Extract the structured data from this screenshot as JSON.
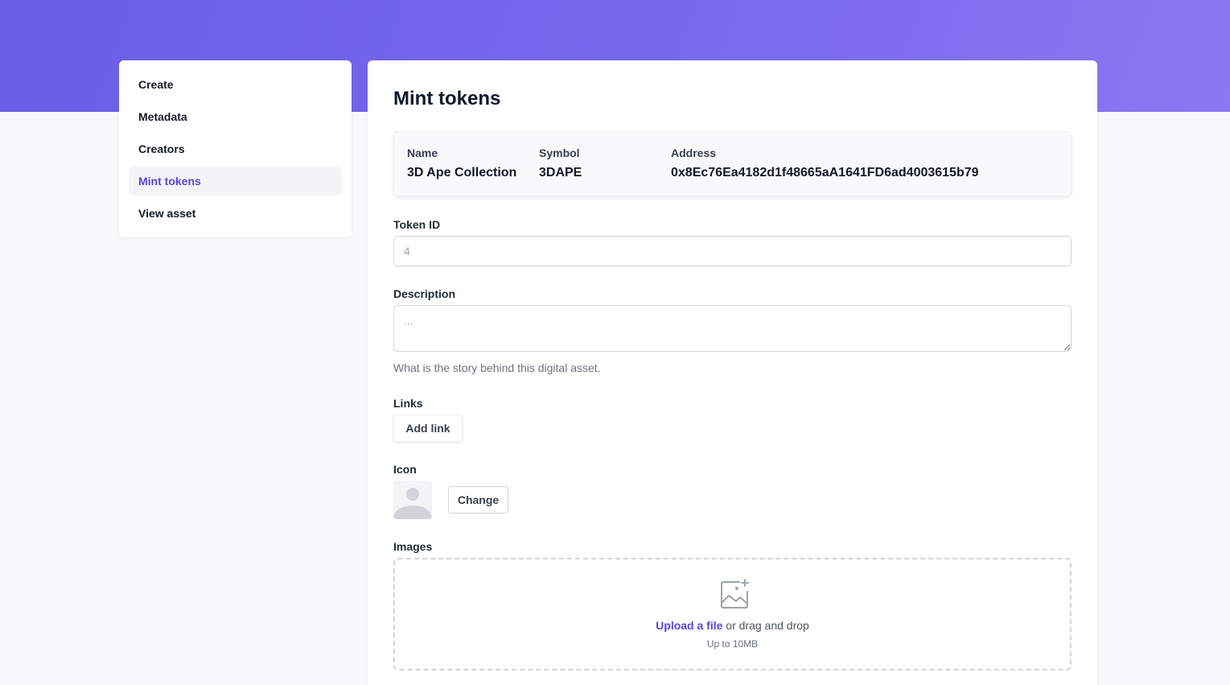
{
  "sidebar": {
    "items": [
      {
        "label": "Create"
      },
      {
        "label": "Metadata"
      },
      {
        "label": "Creators"
      },
      {
        "label": "Mint tokens",
        "active": true
      },
      {
        "label": "View asset"
      }
    ]
  },
  "main": {
    "title": "Mint tokens",
    "info": {
      "name_label": "Name",
      "name_value": "3D Ape Collection",
      "symbol_label": "Symbol",
      "symbol_value": "3DAPE",
      "address_label": "Address",
      "address_value": "0x8Ec76Ea4182d1f48665aA1641FD6ad4003615b79"
    },
    "token_id": {
      "label": "Token ID",
      "placeholder": "4",
      "value": ""
    },
    "description": {
      "label": "Description",
      "placeholder": "...",
      "help": "What is the story behind this digital asset."
    },
    "links": {
      "label": "Links",
      "add_button": "Add link"
    },
    "icon": {
      "label": "Icon",
      "change_button": "Change"
    },
    "images": {
      "label": "Images",
      "upload_link": "Upload a file",
      "upload_rest": " or drag and drop",
      "limit": "Up to 10MB"
    }
  },
  "colors": {
    "accent": "#5b45d6",
    "header_gradient_start": "#6a5de6",
    "header_gradient_end": "#8b78f2",
    "page_background": "#f8f9fb"
  },
  "icons": {
    "image_add": "image-add-icon",
    "avatar_placeholder": "user-placeholder-icon"
  }
}
